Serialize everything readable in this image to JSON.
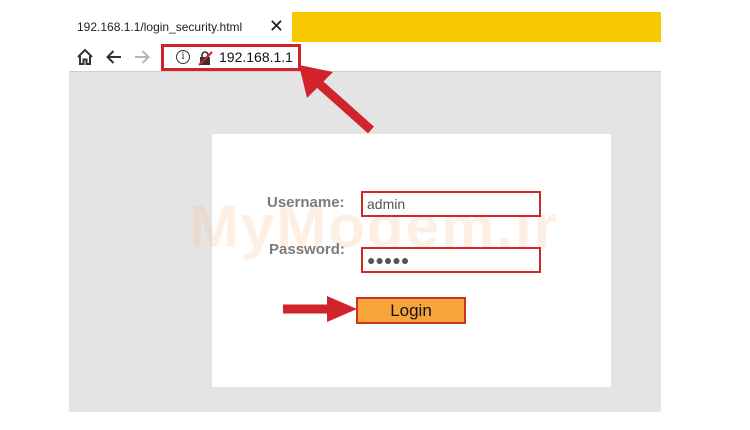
{
  "browser": {
    "tab": {
      "title": "192.168.1.1/login_security.html",
      "close_label": "✕"
    },
    "toolbar": {
      "home_icon": "home-icon",
      "back_icon": "back-arrow-icon",
      "forward_icon": "forward-arrow-icon",
      "info_glyph": "i",
      "url": "192.168.1.1"
    }
  },
  "login": {
    "watermark": "MyModem.ir",
    "username_label": "Username:",
    "username_value": "admin",
    "password_label": "Password:",
    "password_value": "●●●●●",
    "login_button": "Login"
  },
  "colors": {
    "tab_bar": "#f5c800",
    "highlight_red": "#d0232b",
    "button_orange": "#f7a43a",
    "page_grey": "#e4e4e4"
  }
}
